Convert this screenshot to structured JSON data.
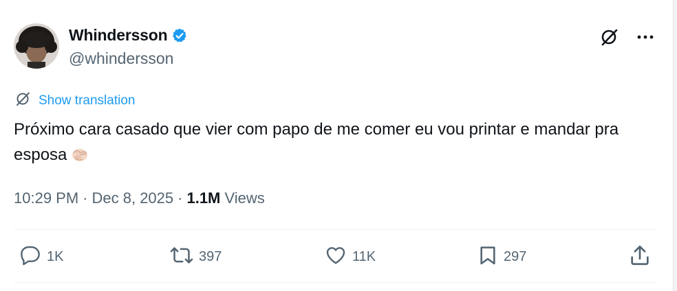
{
  "author": {
    "display_name": "Whindersson",
    "handle": "@whindersson",
    "verified": true
  },
  "translate": {
    "label": "Show translation"
  },
  "tweet": {
    "text": "Próximo cara casado que vier com papo de me comer eu vou printar e mandar pra esposa"
  },
  "meta": {
    "time": "10:29 PM",
    "separator1": "·",
    "date": "Dec 8, 2025",
    "separator2": "·",
    "views_count": "1.1M",
    "views_label": "Views"
  },
  "actions": {
    "replies": "1K",
    "reposts": "397",
    "likes": "11K",
    "bookmarks": "297"
  },
  "colors": {
    "text_primary": "#0f1419",
    "text_secondary": "#536471",
    "accent": "#1d9bf0",
    "divider": "#eff3f4"
  },
  "icons": [
    "grok-icon",
    "more-icon",
    "translate-icon",
    "verified-icon",
    "reply-icon",
    "repost-icon",
    "like-icon",
    "bookmark-icon",
    "share-icon",
    "pointing-emoji-icon"
  ]
}
